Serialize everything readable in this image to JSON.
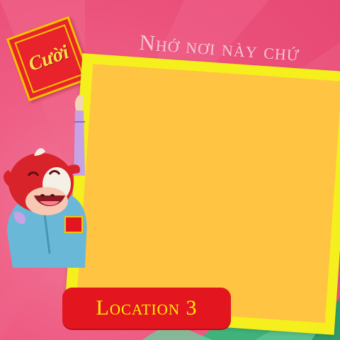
{
  "header": {
    "title": "Nhớ nơi này chứ"
  },
  "badge": {
    "text": "Cười",
    "icon": "cuoi-badge-icon"
  },
  "frame": {
    "outer_color": "#f5ef1d",
    "inner_color": "#fec442"
  },
  "location": {
    "label": "Location 3"
  },
  "mascot": {
    "icon": "cow-mascot-icon"
  },
  "colors": {
    "background": "#ea4f79",
    "accent_red": "#e3161f",
    "accent_yellow": "#fff200",
    "green": "#3fb37a"
  }
}
